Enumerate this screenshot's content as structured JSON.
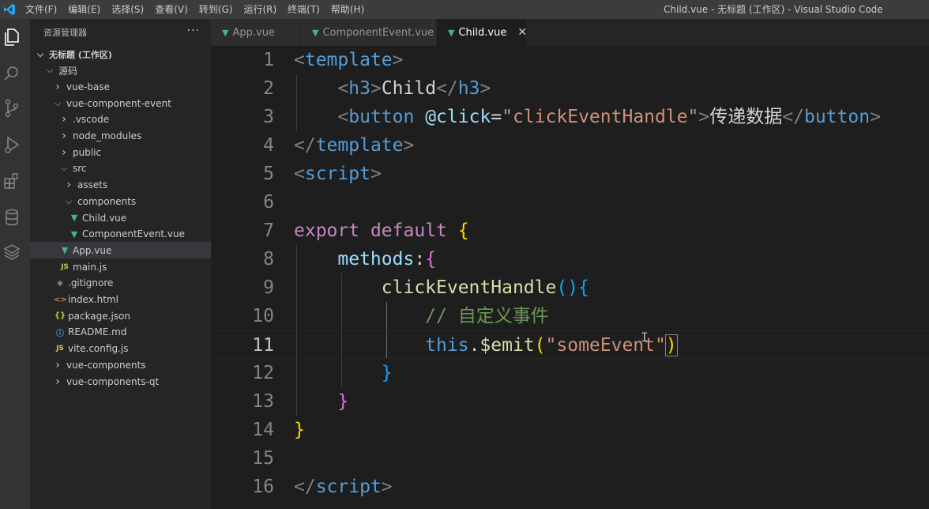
{
  "titlebar": {
    "menus": [
      "文件(F)",
      "编辑(E)",
      "选择(S)",
      "查看(V)",
      "转到(G)",
      "运行(R)",
      "终端(T)",
      "帮助(H)"
    ],
    "window_title": "Child.vue - 无标题 (工作区) - Visual Studio Code"
  },
  "activity_bar": {
    "icons": [
      "explorer-icon",
      "search-icon",
      "source-control-icon",
      "run-debug-icon",
      "extensions-icon",
      "database-icon",
      "layers-icon"
    ]
  },
  "sidebar": {
    "header": "资源管理器",
    "more": "···",
    "tree": [
      {
        "label": "无标题 (工作区)",
        "chev": "v",
        "icon": ""
      },
      {
        "label": "源码",
        "chev": "v",
        "icon": ""
      },
      {
        "label": "vue-base",
        "chev": ">",
        "icon": ""
      },
      {
        "label": "vue-component-event",
        "chev": "v",
        "icon": ""
      },
      {
        "label": ".vscode",
        "chev": ">",
        "icon": ""
      },
      {
        "label": "node_modules",
        "chev": ">",
        "icon": ""
      },
      {
        "label": "public",
        "chev": ">",
        "icon": ""
      },
      {
        "label": "src",
        "chev": "v",
        "icon": ""
      },
      {
        "label": "assets",
        "chev": ">",
        "icon": ""
      },
      {
        "label": "components",
        "chev": "v",
        "icon": ""
      },
      {
        "label": "Child.vue",
        "chev": "",
        "icon": "vue"
      },
      {
        "label": "ComponentEvent.vue",
        "chev": "",
        "icon": "vue"
      },
      {
        "label": "App.vue",
        "chev": "",
        "icon": "vue"
      },
      {
        "label": "main.js",
        "chev": "",
        "icon": "js"
      },
      {
        "label": ".gitignore",
        "chev": "",
        "icon": "git"
      },
      {
        "label": "index.html",
        "chev": "",
        "icon": "html"
      },
      {
        "label": "package.json",
        "chev": "",
        "icon": "json"
      },
      {
        "label": "README.md",
        "chev": "",
        "icon": "info"
      },
      {
        "label": "vite.config.js",
        "chev": "",
        "icon": "js"
      },
      {
        "label": "vue-components",
        "chev": ">",
        "icon": ""
      },
      {
        "label": "vue-components-qt",
        "chev": ">",
        "icon": ""
      }
    ],
    "selected_index": 12
  },
  "tabs": [
    {
      "label": "App.vue",
      "active": false
    },
    {
      "label": "ComponentEvent.vue",
      "active": false
    },
    {
      "label": "Child.vue",
      "active": true
    }
  ],
  "editor": {
    "current_line": 11,
    "lines": [
      {
        "n": "1",
        "tokens": [
          [
            "<",
            "punct"
          ],
          [
            "template",
            "tag"
          ],
          [
            ">",
            "punct"
          ]
        ]
      },
      {
        "n": "2",
        "tokens": [
          [
            "    ",
            "text"
          ],
          [
            "<",
            "punct"
          ],
          [
            "h3",
            "tag"
          ],
          [
            ">",
            "punct"
          ],
          [
            "Child",
            "text"
          ],
          [
            "</",
            "punct"
          ],
          [
            "h3",
            "tag"
          ],
          [
            ">",
            "punct"
          ]
        ]
      },
      {
        "n": "3",
        "tokens": [
          [
            "    ",
            "text"
          ],
          [
            "<",
            "punct"
          ],
          [
            "button",
            "tag"
          ],
          [
            " ",
            "text"
          ],
          [
            "@click",
            "attr"
          ],
          [
            "=",
            "text"
          ],
          [
            "\"clickEventHandle\"",
            "str"
          ],
          [
            ">",
            "punct"
          ],
          [
            "传递数据",
            "text"
          ],
          [
            "</",
            "punct"
          ],
          [
            "button",
            "tag"
          ],
          [
            ">",
            "punct"
          ]
        ]
      },
      {
        "n": "4",
        "tokens": [
          [
            "</",
            "punct"
          ],
          [
            "template",
            "tag"
          ],
          [
            ">",
            "punct"
          ]
        ]
      },
      {
        "n": "5",
        "tokens": [
          [
            "<",
            "punct"
          ],
          [
            "script",
            "tag"
          ],
          [
            ">",
            "punct"
          ]
        ]
      },
      {
        "n": "6",
        "tokens": []
      },
      {
        "n": "7",
        "tokens": [
          [
            "export",
            "kw"
          ],
          [
            " ",
            "text"
          ],
          [
            "default",
            "kw"
          ],
          [
            " ",
            "text"
          ],
          [
            "{",
            "br1"
          ]
        ]
      },
      {
        "n": "8",
        "tokens": [
          [
            "    ",
            "text"
          ],
          [
            "methods",
            "prop"
          ],
          [
            ":",
            "text"
          ],
          [
            "{",
            "br2"
          ]
        ]
      },
      {
        "n": "9",
        "tokens": [
          [
            "        ",
            "text"
          ],
          [
            "clickEventHandle",
            "fn"
          ],
          [
            "()",
            "br3"
          ],
          [
            "{",
            "br3"
          ]
        ]
      },
      {
        "n": "10",
        "tokens": [
          [
            "            ",
            "text"
          ],
          [
            "// 自定义事件",
            "com"
          ]
        ]
      },
      {
        "n": "11",
        "tokens": [
          [
            "            ",
            "text"
          ],
          [
            "this",
            "this"
          ],
          [
            ".",
            "text"
          ],
          [
            "$emit",
            "fn"
          ],
          [
            "(",
            "br1"
          ],
          [
            "\"someEvent\"",
            "str"
          ],
          [
            ")",
            "br1match"
          ]
        ]
      },
      {
        "n": "12",
        "tokens": [
          [
            "        ",
            "text"
          ],
          [
            "}",
            "br3"
          ]
        ]
      },
      {
        "n": "13",
        "tokens": [
          [
            "    ",
            "text"
          ],
          [
            "}",
            "br2"
          ]
        ]
      },
      {
        "n": "14",
        "tokens": [
          [
            "}",
            "br1"
          ]
        ]
      },
      {
        "n": "15",
        "tokens": []
      },
      {
        "n": "16",
        "tokens": [
          [
            "</",
            "punct"
          ],
          [
            "script",
            "tag"
          ],
          [
            ">",
            "punct"
          ]
        ]
      }
    ]
  },
  "colors": {
    "vue_green": "#41b883",
    "tag_blue": "#569cd6",
    "string": "#ce9178",
    "keyword": "#c586c0",
    "function": "#dcdcaa",
    "comment": "#6a9955"
  }
}
